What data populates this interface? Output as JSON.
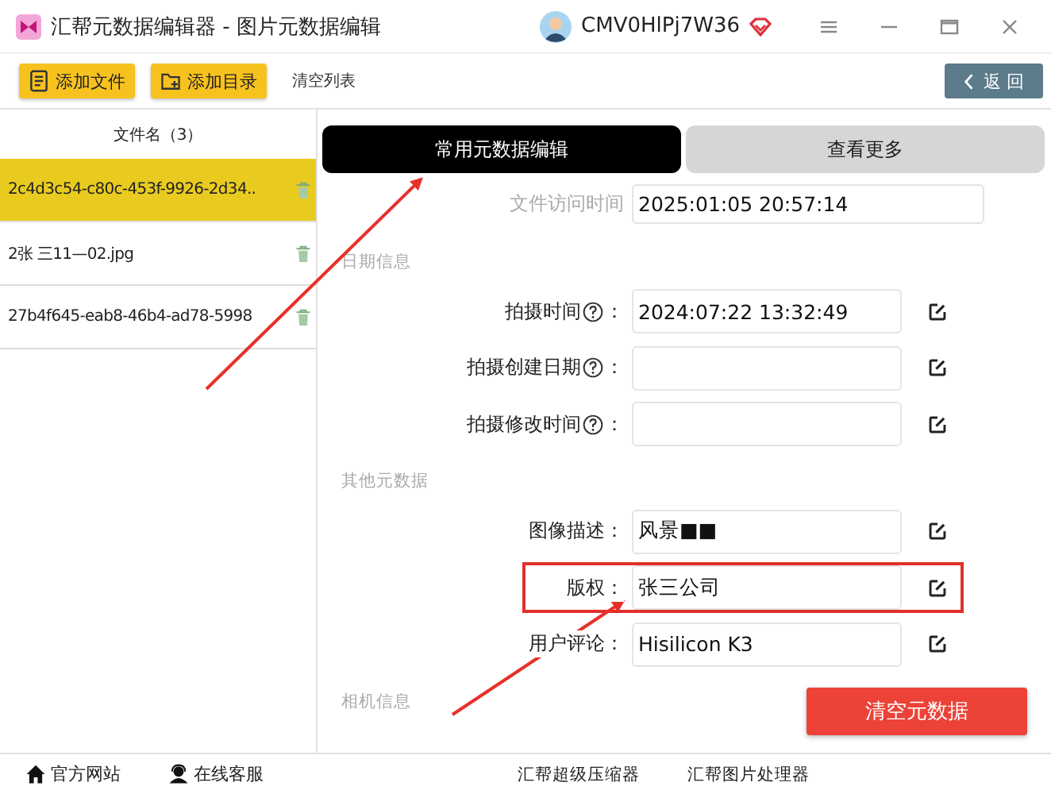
{
  "window": {
    "title": "汇帮元数据编辑器 - 图片元数据编辑",
    "user": "CMV0HlPj7W36"
  },
  "toolbar": {
    "buttons": [
      {
        "label": "添加文件",
        "kind": "file"
      },
      {
        "label": "添加目录",
        "kind": "folder"
      }
    ],
    "clear_list": "清空列表",
    "back": "返 回"
  },
  "file_list": {
    "header": "文件名（3）",
    "items": [
      {
        "name": "2c4d3c54-c80c-453f-9926-2d34..",
        "selected": true
      },
      {
        "name": "2张 三11—02.jpg",
        "selected": false
      },
      {
        "name": "27b4f645-eab8-46b4-ad78-5998",
        "selected": false
      }
    ]
  },
  "tabs": [
    {
      "label": "常用元数据编辑",
      "selected": true
    },
    {
      "label": "查看更多",
      "selected": false
    }
  ],
  "sections": [
    {
      "fields": [
        {
          "label": "文件访问时间",
          "value": "2025:01:05 20:57:14",
          "editable": false
        }
      ]
    },
    {
      "title": "日期信息",
      "fields": [
        {
          "label": "拍摄时间",
          "help": true,
          "suffix": "：",
          "value": "2024:07:22 13:32:49",
          "editable": true
        },
        {
          "label": "拍摄创建日期",
          "help": true,
          "suffix": "：",
          "editable": true
        },
        {
          "label": "拍摄修改时间",
          "help": true,
          "suffix": "：",
          "editable": true
        }
      ]
    },
    {
      "title": "其他元数据",
      "fields": [
        {
          "label": "图像描述：",
          "value": "风景■■",
          "editable": true
        },
        {
          "label": "版权：",
          "value": "张三公司",
          "editable": true,
          "highlighted": true
        },
        {
          "label": "用户评论：",
          "value": "Hisilicon K3",
          "editable": true
        }
      ]
    },
    {
      "title": "相机信息"
    }
  ],
  "clear_metadata": "清空元数据",
  "annotations": [
    {
      "kind": "arrow"
    },
    {
      "kind": "arrow"
    }
  ],
  "footer": {
    "links": [
      {
        "label": "官方网站",
        "kind": "home"
      },
      {
        "label": "在线客服",
        "kind": "support"
      }
    ],
    "apps": [
      "汇帮超级压缩器",
      "汇帮图片处理器"
    ]
  }
}
